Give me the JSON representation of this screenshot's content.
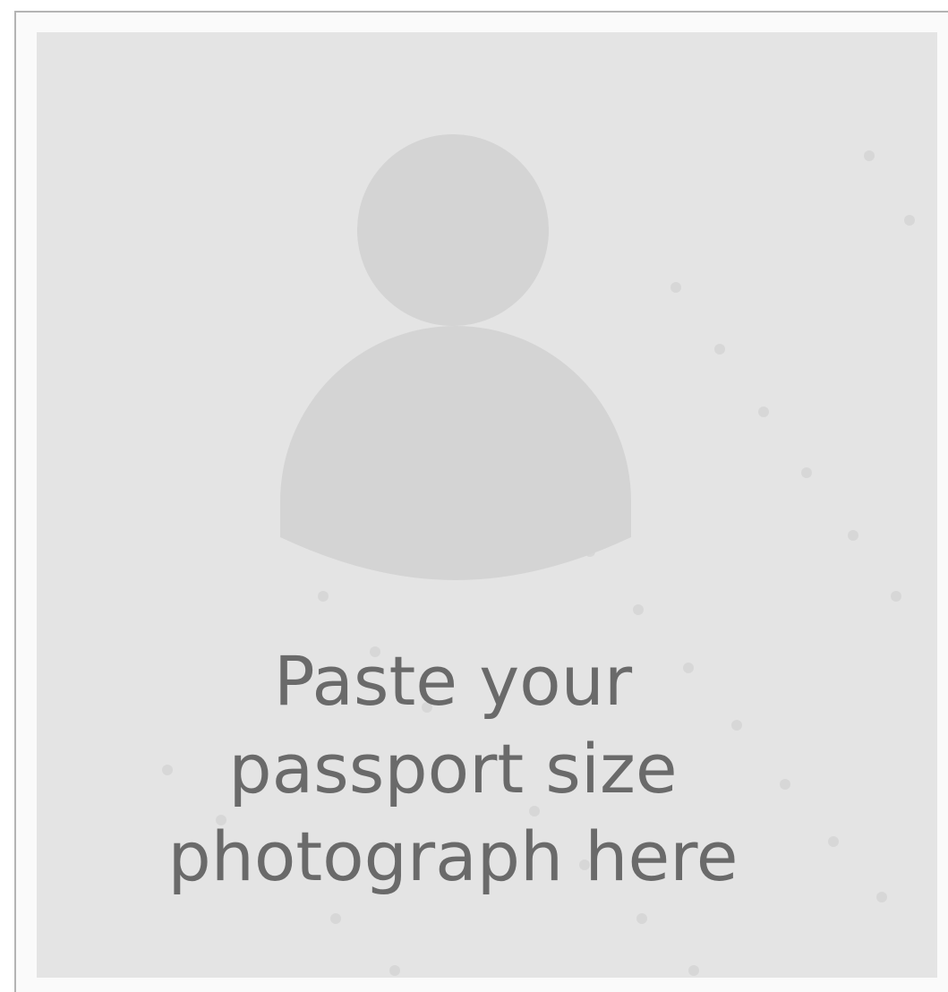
{
  "placeholder": {
    "icon": "person-silhouette-icon",
    "caption_lines": [
      "Paste your",
      "passport size",
      "photograph here"
    ],
    "colors": {
      "background": "#e4e4e4",
      "silhouette": "#d4d4d4",
      "caption_text": "#6a6a6a",
      "border": "#b4b4b4"
    }
  }
}
